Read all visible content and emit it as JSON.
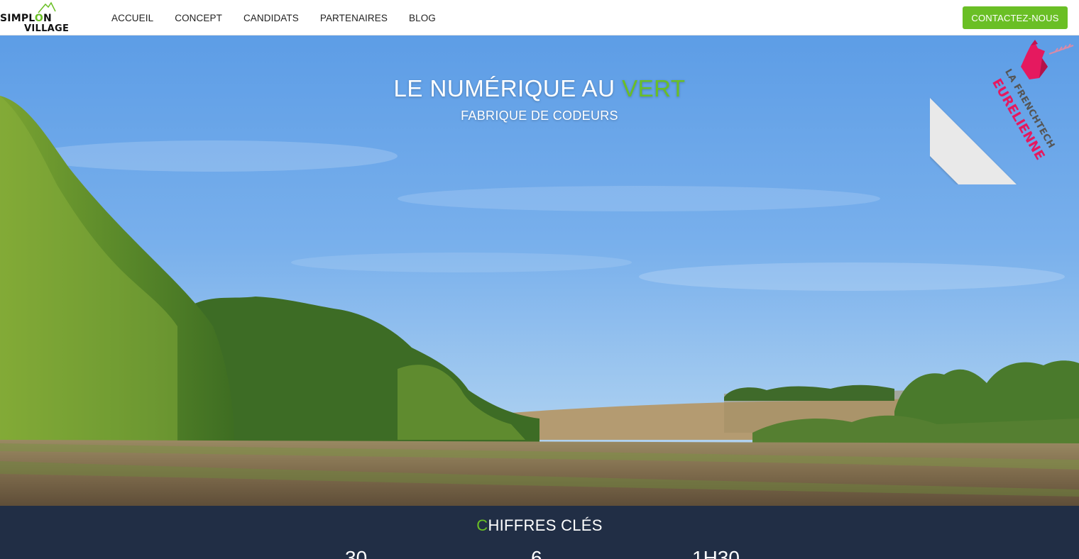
{
  "navbar": {
    "logo": {
      "line1_a": "SIMPL",
      "line1_o": "O",
      "line1_b": "N",
      "line2": "VILLAGE"
    },
    "links": [
      "ACCUEIL",
      "CONCEPT",
      "CANDIDATS",
      "PARTENAIRES",
      "BLOG"
    ],
    "contact_label": "CONTACTEZ-NOUS"
  },
  "hero": {
    "title_main": "LE NUMÉRIQUE AU ",
    "title_accent": "VERT",
    "subtitle": "FABRIQUE DE CODEURS",
    "ribbon_line1": "LA FRENCHTECH",
    "ribbon_line2": "EURELIENNE"
  },
  "stats": {
    "title_first": "C",
    "title_rest": "HIFFRES CLÉS",
    "figures": [
      "30",
      "6",
      "1H30"
    ]
  },
  "colors": {
    "accent_green": "#6abf25",
    "stats_bg": "#212e45",
    "ribbon_pink": "#e5195f"
  }
}
